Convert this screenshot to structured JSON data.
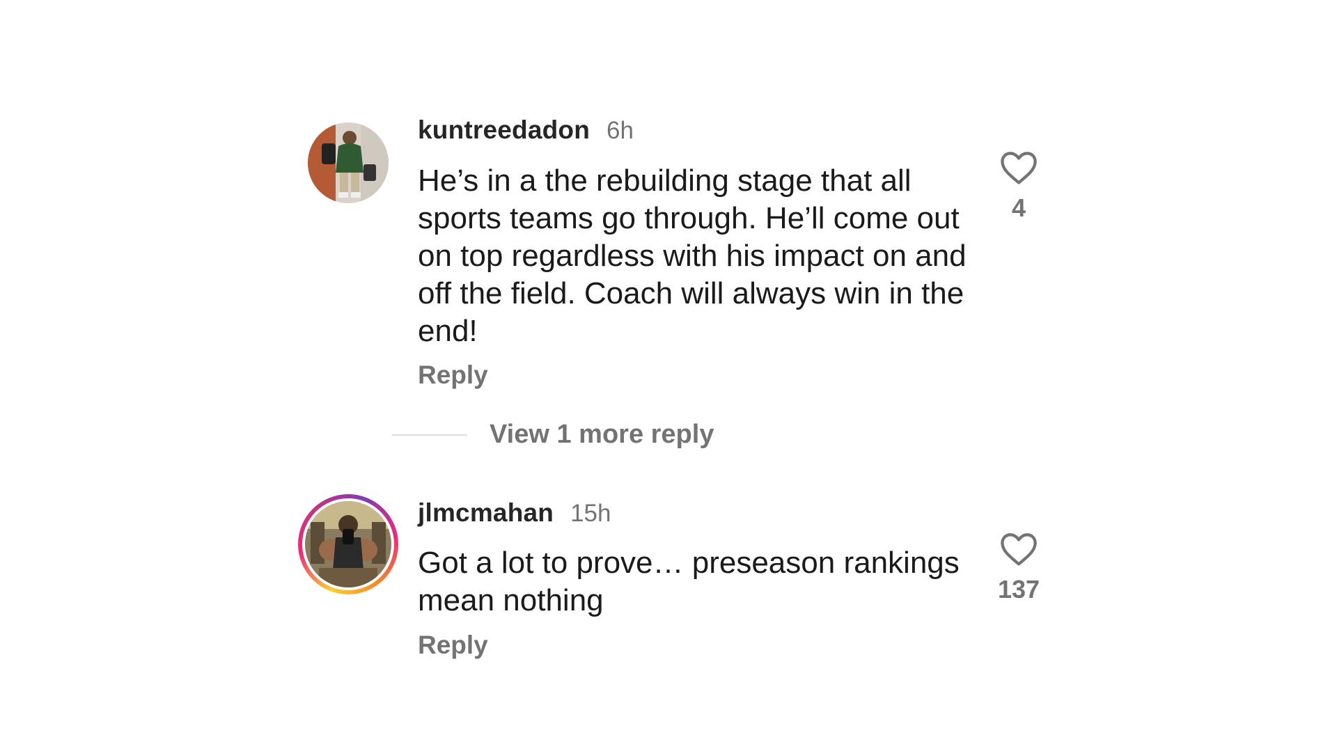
{
  "comments": [
    {
      "username": "kuntreedadon",
      "time": "6h",
      "text": "He’s in a the rebuilding stage that all sports teams go through. He’ll come out on top regardless with his impact on and off the field. Coach will always win in the end!",
      "reply_label": "Reply",
      "likes": "4",
      "icon": "heart-outline-icon",
      "has_story_ring": false
    },
    {
      "username": "jlmcmahan",
      "time": "15h",
      "text": "Got a lot to prove… preseason rankings mean nothing",
      "reply_label": "Reply",
      "likes": "137",
      "icon": "heart-outline-icon",
      "has_story_ring": true
    }
  ],
  "view_more_replies": "View 1 more reply",
  "colors": {
    "text_primary": "#1a1a1a",
    "text_secondary": "#737373",
    "divider": "#dbdbdb",
    "story_ring": [
      "#f9ce34",
      "#ee2a7b",
      "#833ab4"
    ]
  }
}
